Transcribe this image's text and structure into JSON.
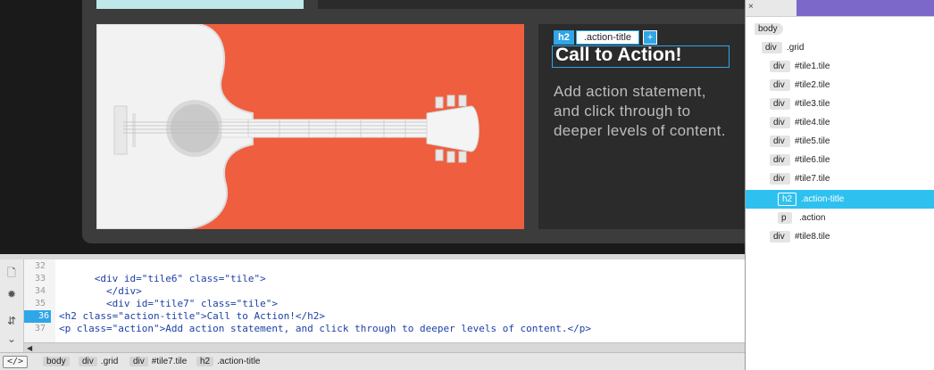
{
  "live_view": {
    "tag_chip": {
      "tag": "h2",
      "class_name": ".action-title",
      "add": "+"
    },
    "title": "Call to Action!",
    "action_text": "Add action statement, and click through to deeper levels of content."
  },
  "dom_panel": {
    "close": "×",
    "rows": [
      {
        "tag": "body",
        "label": ""
      },
      {
        "tag": "div",
        "label": ".grid"
      },
      {
        "tag": "div",
        "label": "#tile1.tile"
      },
      {
        "tag": "div",
        "label": "#tile2.tile"
      },
      {
        "tag": "div",
        "label": "#tile3.tile"
      },
      {
        "tag": "div",
        "label": "#tile4.tile"
      },
      {
        "tag": "div",
        "label": "#tile5.tile"
      },
      {
        "tag": "div",
        "label": "#tile6.tile"
      },
      {
        "tag": "div",
        "label": "#tile7.tile"
      },
      {
        "tag": "h2",
        "label": ".action-title"
      },
      {
        "tag": "p",
        "label": ".action"
      },
      {
        "tag": "div",
        "label": "#tile8.tile"
      }
    ]
  },
  "code": {
    "line_numbers": [
      "32",
      "33",
      "34",
      "35",
      "36",
      "37"
    ],
    "lines": [
      "",
      "      <div id=\"tile6\" class=\"tile\">",
      "        </div>",
      "        <div id=\"tile7\" class=\"tile\">",
      "<h2 class=\"action-title\">Call to Action!</h2>",
      "<p class=\"action\">Add action statement, and click through to deeper levels of content.</p>"
    ]
  },
  "status_bar": {
    "code_toggle": "</>",
    "crumbs": [
      {
        "tag": "body",
        "label": ""
      },
      {
        "tag": "div",
        "label": ".grid"
      },
      {
        "tag": "div",
        "label": "#tile7.tile"
      },
      {
        "tag": "h2",
        "label": ".action-title"
      }
    ]
  },
  "colors": {
    "accent": "#2fa6e8",
    "selected_row": "#2ec1f0",
    "tile_orange": "#ee5e3f"
  }
}
